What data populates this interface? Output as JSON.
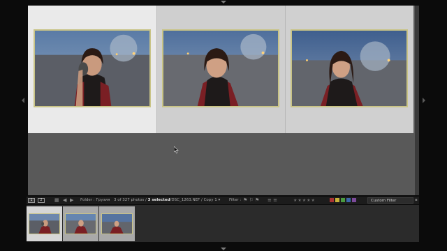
{
  "toolbar": {
    "monitor_primary": "1",
    "monitor_secondary": "2",
    "source": "Folder : Грузия",
    "count_text": "3 of 327 photos /",
    "selected_text": "3 selected",
    "file_text": "/DSC_1263.NEF / Copy 1 ▾",
    "filter_label": "Filter :",
    "custom_filter": "Custom Filter",
    "stars": "★★★★★"
  },
  "colors": {
    "workspace": "#595959",
    "selected_cell": "#eaeaea",
    "cell": "#cfcfcf",
    "photo_border": "#c9c486",
    "toolbar": "#1c1c1c",
    "filmstrip": "#2b2b2b"
  },
  "icons": {
    "grid": "grid-icon",
    "back": "arrow-left-icon",
    "forward": "arrow-right-icon",
    "cursor": "mouse-cursor-icon",
    "lock": "lock-icon"
  },
  "photos": [
    {
      "id": "1",
      "pose": "stone"
    },
    {
      "id": "2",
      "pose": "front"
    },
    {
      "id": "3",
      "pose": "side"
    }
  ]
}
